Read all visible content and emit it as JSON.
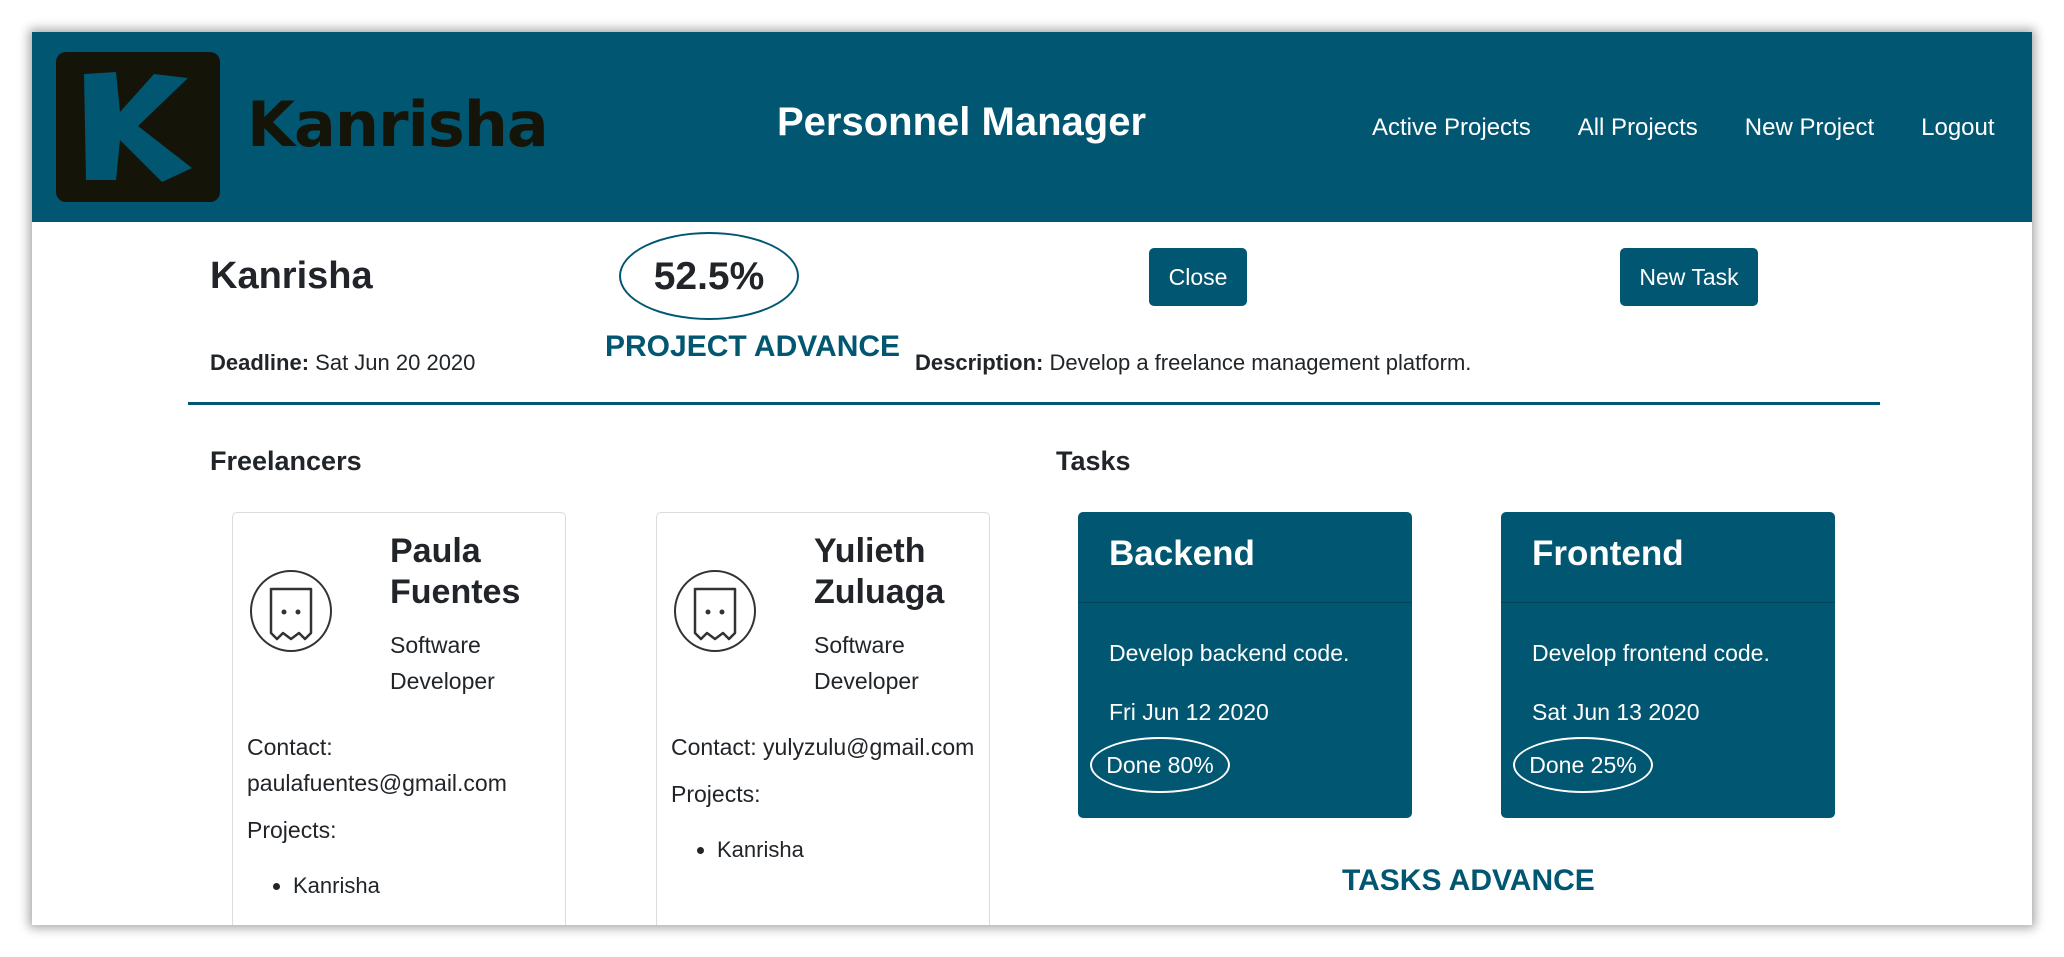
{
  "navbar": {
    "logo_text": "Kanrisha",
    "title": "Personnel Manager",
    "links": [
      "Active Projects",
      "All Projects",
      "New Project",
      "Logout"
    ]
  },
  "project": {
    "name": "Kanrisha",
    "advance": "52.5%",
    "advance_caption": "PROJECT ADVANCE",
    "close_label": "Close",
    "new_task_label": "New Task",
    "deadline_label": "Deadline:",
    "deadline": "Sat Jun 20 2020",
    "description_label": "Description:",
    "description": "Develop a freelance management platform."
  },
  "freelancers": {
    "title": "Freelancers",
    "items": [
      {
        "name": "Paula Fuentes",
        "role": "Software Developer",
        "contact": "Contact: paulafuentes@gmail.com",
        "projects_label": "Projects:",
        "projects": [
          "Kanrisha"
        ]
      },
      {
        "name": "Yulieth Zuluaga",
        "role": "Software Developer",
        "contact": "Contact: yulyzulu@gmail.com",
        "projects_label": "Projects:",
        "projects": [
          "Kanrisha"
        ]
      }
    ]
  },
  "tasks": {
    "title": "Tasks",
    "caption": "TASKS ADVANCE",
    "items": [
      {
        "title": "Backend",
        "description": "Develop backend code.",
        "date": "Fri Jun 12 2020",
        "done": "Done 80%"
      },
      {
        "title": "Frontend",
        "description": "Develop frontend code.",
        "date": "Sat Jun 13 2020",
        "done": "Done 25%"
      }
    ]
  },
  "colors": {
    "primary": "#015671",
    "logo_dark": "#151409"
  },
  "icons": [
    "logo-k-icon",
    "avatar-icon"
  ]
}
